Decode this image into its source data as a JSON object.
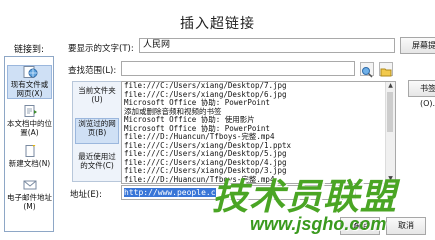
{
  "dialog": {
    "title": "插入超链接",
    "link_to_label": "链接到:",
    "link_to_items": [
      {
        "label": "现有文件或网页(X)",
        "icon": "globe-page-icon"
      },
      {
        "label": "本文档中的位置(A)",
        "icon": "document-place-icon"
      },
      {
        "label": "新建文档(N)",
        "icon": "new-document-icon"
      },
      {
        "label": "电子邮件地址(M)",
        "icon": "email-icon"
      }
    ],
    "display_text_label": "要显示的文字(T):",
    "display_text_value": "人民网",
    "screen_tip_label": "屏幕提示(P)...",
    "look_in_label": "查找范围(L):",
    "look_in_value": "",
    "nav_items": [
      {
        "label": "当前文件夹(U)"
      },
      {
        "label": "浏览过的网页(B)"
      },
      {
        "label": "最近使用过的文件(C)"
      }
    ],
    "files": [
      "file:///C:/Users/xiang/Desktop/7.jpg",
      "file:///C:/Users/xiang/Desktop/6.jpg",
      "Microsoft Office 协助: PowerPoint",
      "添加或删除音频和视频的书签",
      "Microsoft Office 协助: 使用影片",
      "Microsoft Office 协助: PowerPoint",
      "file:///D:/Huancun/Tfboys-完整.mp4",
      "file:///C:/Users/xiang/Desktop/1.pptx",
      "file:///C:/Users/xiang/Desktop/5.jpg",
      "file:///C:/Users/xiang/Desktop/4.jpg",
      "file:///C:/Users/xiang/Desktop/3.jpg",
      "file:///D:/Huancun/Tfboys-完整.mp4"
    ],
    "bookmark_label": "书签(O)...",
    "address_label": "地址(E):",
    "address_value": "http://www.people.c",
    "ok_label": "确定",
    "cancel_label": "取消"
  },
  "watermark": {
    "line1": "技术员联盟",
    "line2": "www.jsgho.com"
  }
}
